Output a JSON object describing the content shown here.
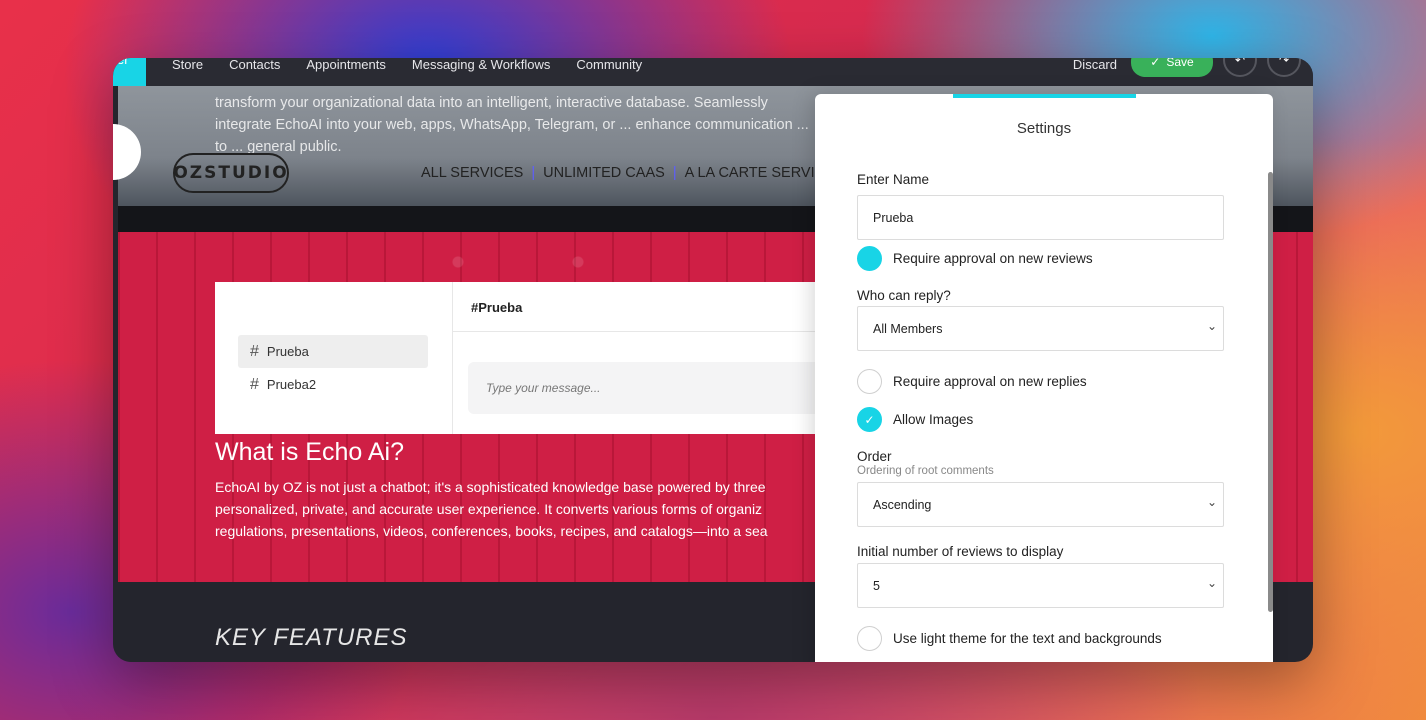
{
  "topbar": {
    "accent_tab": "er",
    "nav": [
      "Store",
      "Contacts",
      "Appointments",
      "Messaging & Workflows",
      "Community"
    ],
    "discard": "Discard",
    "save": "Save",
    "save_icon": "check-icon"
  },
  "hero": {
    "text": "transform your organizational data into an intelligent, interactive database. Seamlessly integrate EchoAI into your web, apps, WhatsApp, Telegram, or ... enhance communication ... to ... general public.",
    "brand": "OZSTUDIO",
    "menu": [
      "ALL SERVICES",
      "UNLIMITED CAAS",
      "A LA CARTE SERVIC"
    ]
  },
  "chat": {
    "channels": [
      "Prueba",
      "Prueba2"
    ],
    "header": "#Prueba",
    "input_placeholder": "Type your message..."
  },
  "echo": {
    "title": "What is Echo Ai?",
    "lines": [
      "EchoAI by OZ is not just a chatbot; it's a sophisticated knowledge base powered by three",
      "personalized, private, and accurate user experience. It converts various forms of organiz",
      "regulations, presentations, videos, conferences, books, recipes, and catalogs—into a sea"
    ]
  },
  "key_features": "KEY FEATURES",
  "settings": {
    "title": "Settings",
    "name_label": "Enter Name",
    "name_value": "Prueba",
    "require_reviews": {
      "label": "Require approval on new reviews",
      "checked": true
    },
    "who_reply_label": "Who can reply?",
    "who_reply_value": "All Members",
    "require_replies": {
      "label": "Require approval on new replies",
      "checked": false
    },
    "allow_images": {
      "label": "Allow Images",
      "checked": true
    },
    "order_label": "Order",
    "order_sub": "Ordering of root comments",
    "order_value": "Ascending",
    "initial_label": "Initial number of reviews to display",
    "initial_value": "5",
    "light_theme": {
      "label": "Use light theme for the text and backgrounds",
      "checked": false
    }
  },
  "colors": {
    "accent": "#18d4e6",
    "save": "#39b15a",
    "red_section": "#cf1f45"
  }
}
